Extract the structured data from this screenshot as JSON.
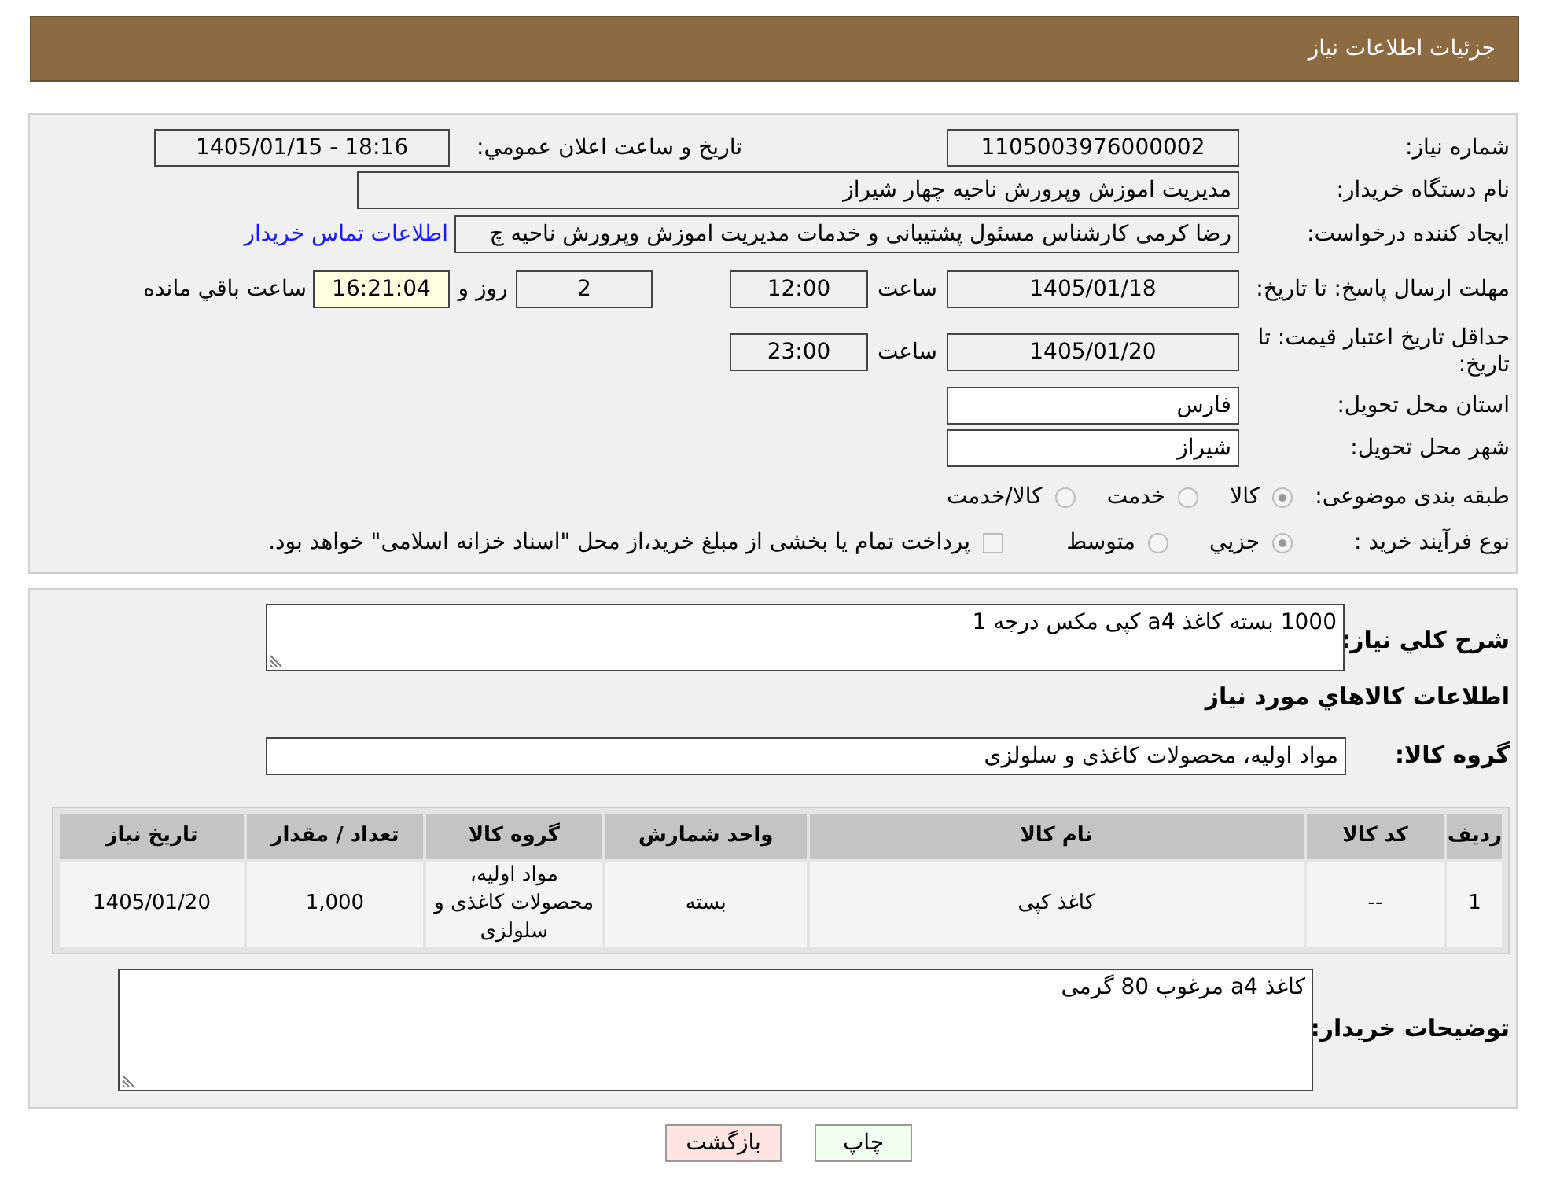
{
  "header": {
    "title": "جزئیات اطلاعات نیاز"
  },
  "need_number": {
    "label": "شماره نیاز:",
    "value": "1105003976000002"
  },
  "announce": {
    "label": "تاریخ و ساعت اعلان عمومي:",
    "value": "1405/01/15 - 18:16"
  },
  "buyer": {
    "label": "نام دستگاه خریدار:",
    "value": "مدیریت اموزش وپرورش ناحیه چهار شیراز"
  },
  "requester": {
    "label": "ایجاد کننده درخواست:",
    "value": "رضا کرمی کارشناس مسئول پشتیبانی و خدمات مدیریت اموزش وپرورش ناحیه چ",
    "link": "اطلاعات تماس خریدار"
  },
  "deadline": {
    "label": "مهلت ارسال پاسخ: تا تاریخ:",
    "date": "1405/01/18",
    "time_label": "ساعت",
    "time": "12:00",
    "days": "2",
    "days_label": "روز و",
    "remaining": "16:21:04",
    "remaining_label": "ساعت باقي مانده"
  },
  "validity": {
    "label": "حداقل تاریخ اعتبار قیمت: تا تاریخ:",
    "date": "1405/01/20",
    "time_label": "ساعت",
    "time": "23:00"
  },
  "province": {
    "label": "استان محل تحویل:",
    "value": "فارس"
  },
  "city": {
    "label": "شهر محل تحویل:",
    "value": "شیراز"
  },
  "category": {
    "label": "طبقه بندی موضوعی:",
    "options": [
      {
        "label": "کالا",
        "selected": true
      },
      {
        "label": "خدمت",
        "selected": false
      },
      {
        "label": "کالا/خدمت",
        "selected": false
      }
    ]
  },
  "process": {
    "label": "نوع فرآیند خرید :",
    "options": [
      {
        "label": "جزيي",
        "selected": true
      },
      {
        "label": "متوسط",
        "selected": false
      }
    ],
    "payment": {
      "checked": false,
      "text": "پرداخت تمام یا بخشی از مبلغ خرید،از محل \"اسناد خزانه اسلامی\" خواهد بود."
    }
  },
  "description": {
    "label": "شرح كلي نياز:",
    "value": "1000 بسته کاغذ a4 کپی مکس درجه 1"
  },
  "goods_title": "اطلاعات كالاهاي مورد نياز",
  "goods_group": {
    "label": "گروه کالا:",
    "value": "مواد اولیه، محصولات کاغذی و سلولزی"
  },
  "table": {
    "columns": [
      "ردیف",
      "کد کالا",
      "نام کالا",
      "واحد شمارش",
      "گروه کالا",
      "تعداد / مقدار",
      "تاریخ نیاز"
    ],
    "rows": [
      [
        "1",
        "--",
        "کاغذ کپی",
        "بسته",
        "مواد اولیه، محصولات کاغذی و سلولزی",
        "1,000",
        "1405/01/20"
      ]
    ]
  },
  "buyer_notes": {
    "label": "توضیحات خریدار:",
    "value": "کاغذ a4 مرغوب 80 گرمی"
  },
  "buttons": [
    {
      "label": "چاپ",
      "kind": "print"
    },
    {
      "label": "بازگشت",
      "kind": "back"
    }
  ]
}
